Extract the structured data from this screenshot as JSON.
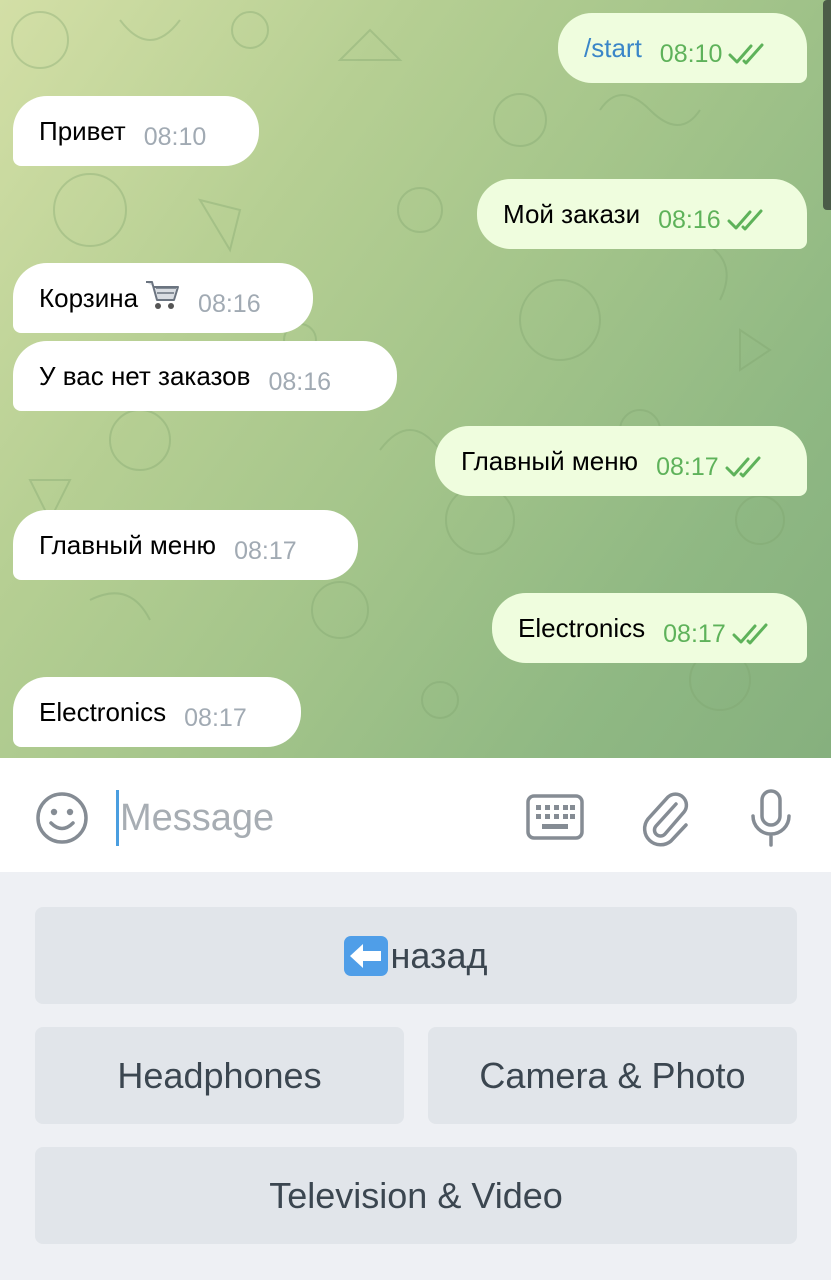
{
  "chat": {
    "messages": [
      {
        "dir": "out",
        "text": "/start",
        "time": "08:10",
        "is_command": true
      },
      {
        "dir": "in",
        "text": "Привет",
        "time": "08:10"
      },
      {
        "dir": "out",
        "text": "Мой закази",
        "time": "08:16"
      },
      {
        "dir": "in",
        "text": "Корзина",
        "emoji": "shopping-cart",
        "time": "08:16"
      },
      {
        "dir": "in",
        "text": "У вас нет заказов",
        "time": "08:16"
      },
      {
        "dir": "out",
        "text": "Главный меню",
        "time": "08:17"
      },
      {
        "dir": "in",
        "text": "Главный меню",
        "time": "08:17"
      },
      {
        "dir": "out",
        "text": "Electronics",
        "time": "08:17"
      },
      {
        "dir": "in",
        "text": "Electronics",
        "time": "08:17"
      }
    ],
    "read_status_icon": "double-check-icon"
  },
  "composer": {
    "placeholder": "Message",
    "value": "",
    "icons": [
      "emoji-icon",
      "keyboard-icon",
      "attach-icon",
      "microphone-icon"
    ]
  },
  "bot_keyboard": {
    "back_label": "назад",
    "back_emoji": "left-arrow-emoji",
    "headphones_label": "Headphones",
    "camera_label": "Camera & Photo",
    "tv_label": "Television & Video"
  },
  "colors": {
    "incoming_bubble": "#ffffff",
    "outgoing_bubble": "#effdde",
    "outgoing_time": "#5eb25a",
    "incoming_time": "#a1aab3",
    "command_link": "#3a86c8",
    "keyboard_button": "#e1e5ea"
  }
}
